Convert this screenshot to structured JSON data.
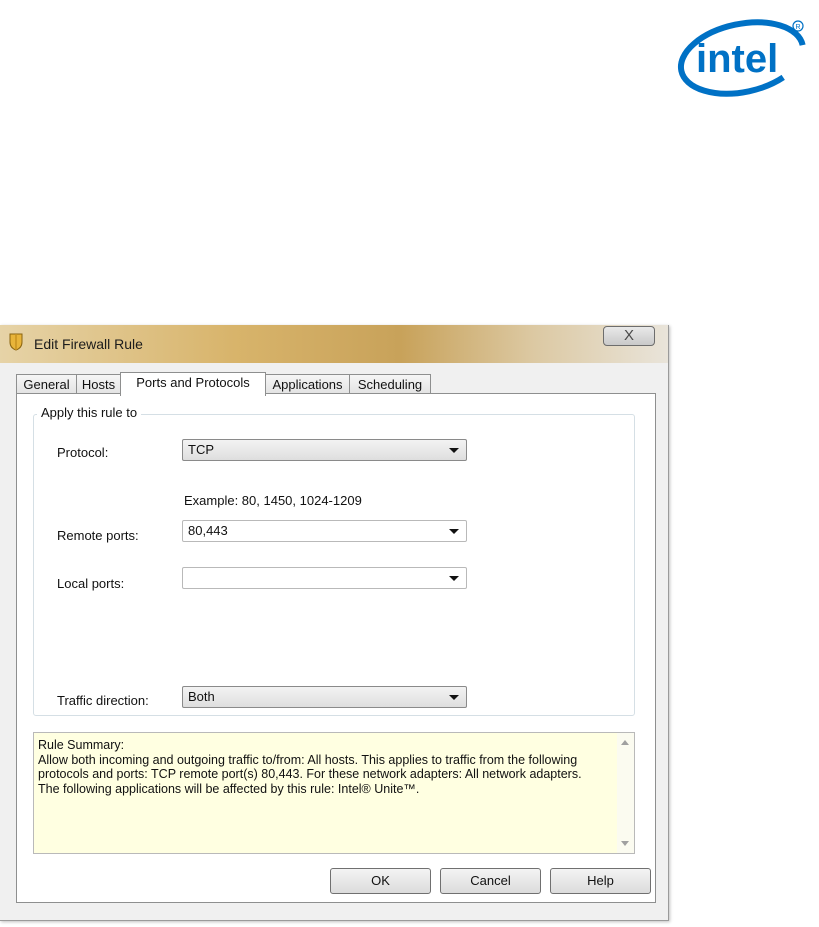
{
  "logo": {
    "text": "intel"
  },
  "window": {
    "title": "Edit Firewall Rule",
    "close_glyph": "X"
  },
  "tabs": [
    {
      "label": "General"
    },
    {
      "label": "Hosts"
    },
    {
      "label": "Ports and Protocols",
      "active": true
    },
    {
      "label": "Applications"
    },
    {
      "label": "Scheduling"
    }
  ],
  "group": {
    "legend": "Apply this rule to"
  },
  "fields": {
    "protocol_label": "Protocol:",
    "protocol_value": "TCP",
    "example": "Example: 80, 1450, 1024-1209",
    "remote_ports_label": "Remote ports:",
    "remote_ports_value": "80,443",
    "local_ports_label": "Local ports:",
    "local_ports_value": "",
    "traffic_direction_label": "Traffic direction:",
    "traffic_direction_value": "Both"
  },
  "summary": {
    "heading": "Rule Summary:",
    "line1": "Allow both incoming and outgoing traffic to/from: All hosts. This applies to traffic from the following protocols and ports: TCP remote port(s) 80,443. For these network adapters: All network adapters.",
    "line2": "The following applications will be affected by this rule: Intel® Unite™."
  },
  "buttons": {
    "ok": "OK",
    "cancel": "Cancel",
    "help": "Help"
  },
  "colors": {
    "intel_blue": "#0071c5",
    "summary_bg": "#ffffe1"
  }
}
